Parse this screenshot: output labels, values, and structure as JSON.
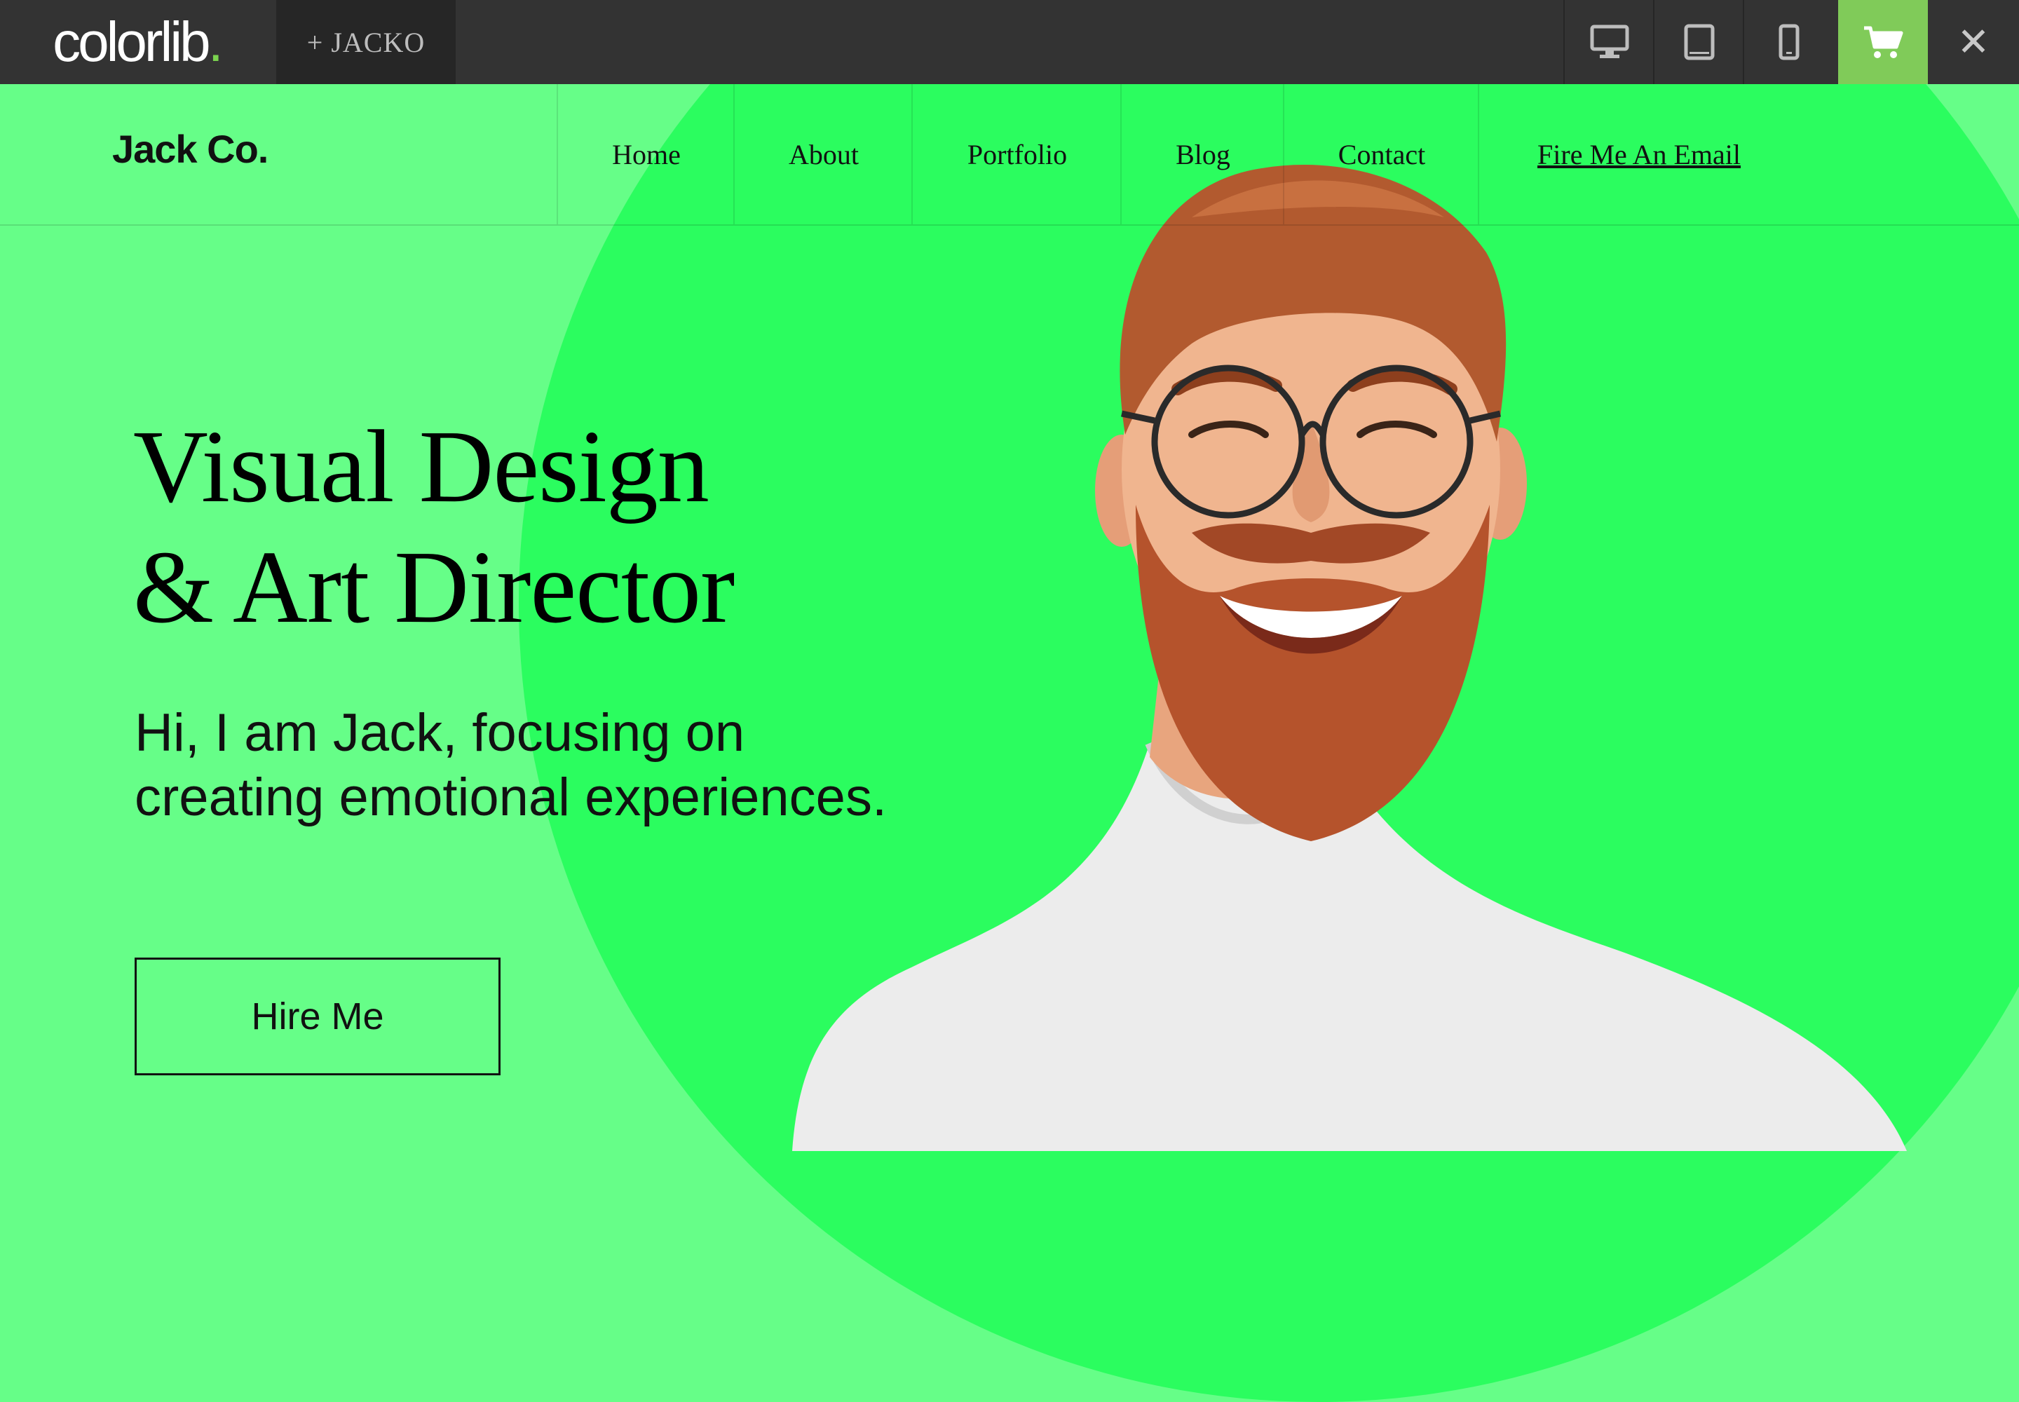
{
  "preview_bar": {
    "brand_word": "colorlib",
    "brand_dot": ".",
    "theme_tab": "+ JACKO",
    "icons": [
      "desktop-icon",
      "tablet-icon",
      "mobile-icon",
      "cart-icon",
      "close-icon"
    ],
    "close_glyph": "✕"
  },
  "site": {
    "logo": "Jack Co.",
    "nav": [
      {
        "label": "Home"
      },
      {
        "label": "About"
      },
      {
        "label": "Portfolio"
      },
      {
        "label": "Blog"
      },
      {
        "label": "Contact"
      },
      {
        "label": "Fire Me An Email"
      }
    ]
  },
  "hero": {
    "headline_line1": "Visual Design",
    "headline_line2": "& Art Director",
    "intro": "Hi, I am Jack, focusing on creating emotional experiences.",
    "cta": "Hire Me",
    "portrait": "portrait-photo"
  },
  "colors": {
    "topbar": "#333333",
    "brand_accent": "#7bd34f",
    "cart_button": "#80cb59",
    "page_background": "#66fe88",
    "hero_circle": "#2bfd5f"
  }
}
